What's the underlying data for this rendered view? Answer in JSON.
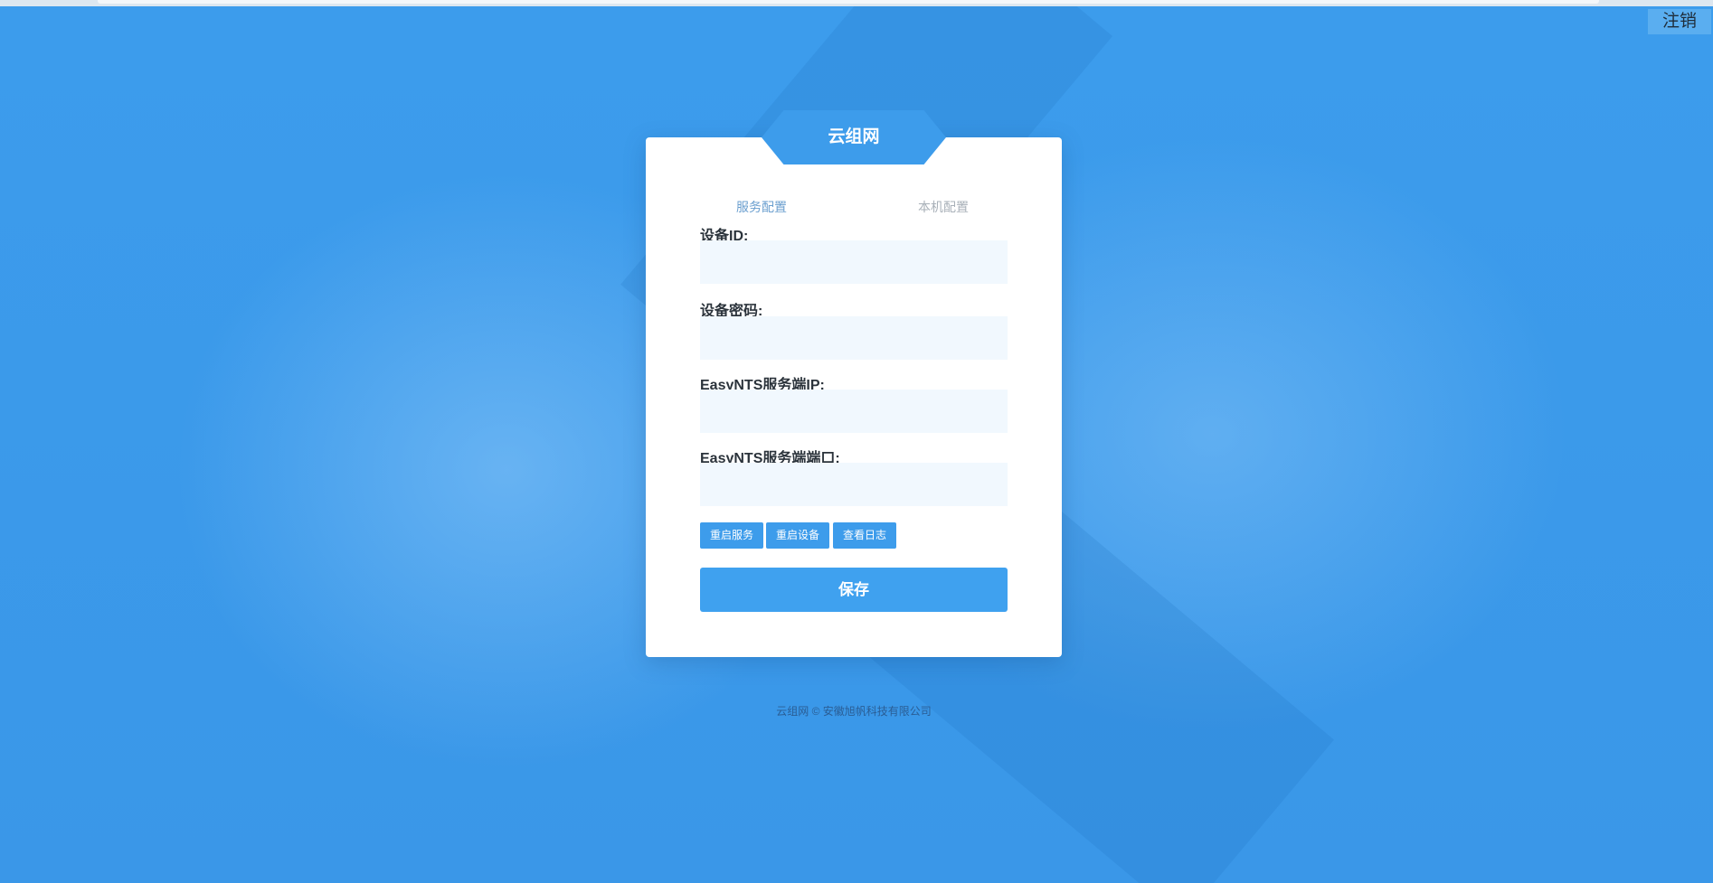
{
  "header": {
    "logout_label": "注销"
  },
  "card": {
    "title": "云组网",
    "tabs": [
      {
        "label": "服务配置",
        "active": true
      },
      {
        "label": "本机配置",
        "active": false
      }
    ],
    "fields": [
      {
        "label": "设备ID:",
        "value": "",
        "placeholder": ""
      },
      {
        "label": "设备密码:",
        "value": "",
        "placeholder": ""
      },
      {
        "label": "EasyNTS服务端IP:",
        "value": "",
        "placeholder": ""
      },
      {
        "label": "EasyNTS服务端端口:",
        "value": "",
        "placeholder": ""
      }
    ],
    "actions": {
      "restart_service": "重启服务",
      "restart_device": "重启设备",
      "view_log": "查看日志"
    },
    "save_label": "保存"
  },
  "footer": {
    "copyright": "云组网 © 安徽旭帆科技有限公司"
  },
  "colors": {
    "background": "#3b9ae9",
    "accent": "#3d9ceb",
    "input_bg": "#f1f8fe"
  }
}
